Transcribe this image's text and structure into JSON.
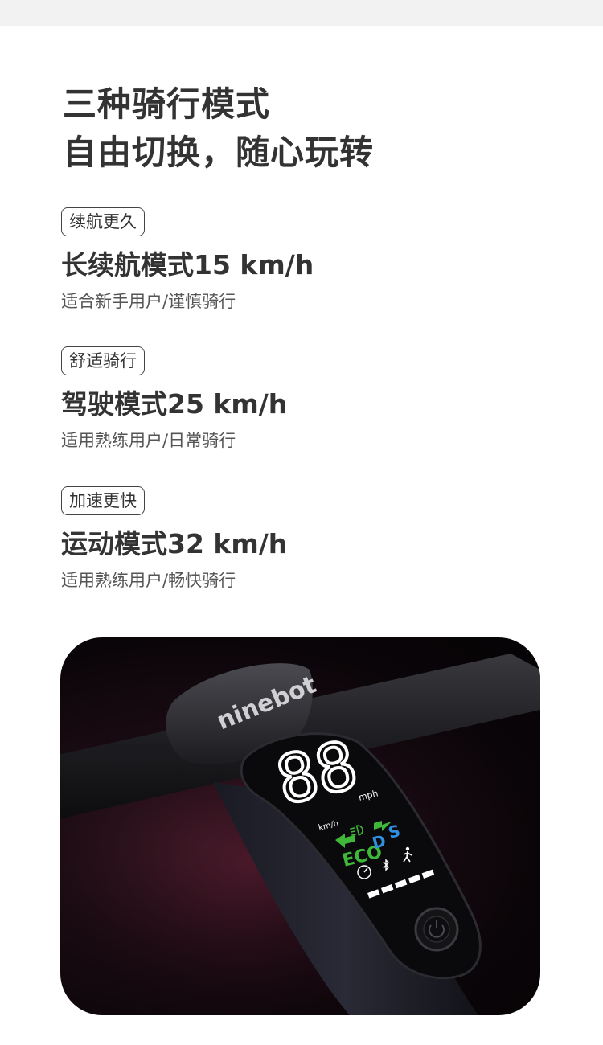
{
  "headline": {
    "line1": "三种骑行模式",
    "line2": "自由切换，随心玩转"
  },
  "modes": [
    {
      "tag": "续航更久",
      "title": "长续航模式15 km/h",
      "desc": "适合新手用户/谨慎骑行"
    },
    {
      "tag": "舒适骑行",
      "title": "驾驶模式25 km/h",
      "desc": "适用熟练用户/日常骑行"
    },
    {
      "tag": "加速更快",
      "title": "运动模式32 km/h",
      "desc": "适用熟练用户/畅快骑行"
    }
  ],
  "photo": {
    "brand": "ninebot",
    "speed_digits": "88",
    "unit_kmh": "km/h",
    "unit_mph": "mph",
    "mode_eco": "ECO",
    "mode_d": "D",
    "mode_s": "S",
    "colors": {
      "eco": "#3fb83a",
      "d": "#2f8fe0",
      "s": "#2f8fe0",
      "arrow": "#3fb83a"
    }
  }
}
